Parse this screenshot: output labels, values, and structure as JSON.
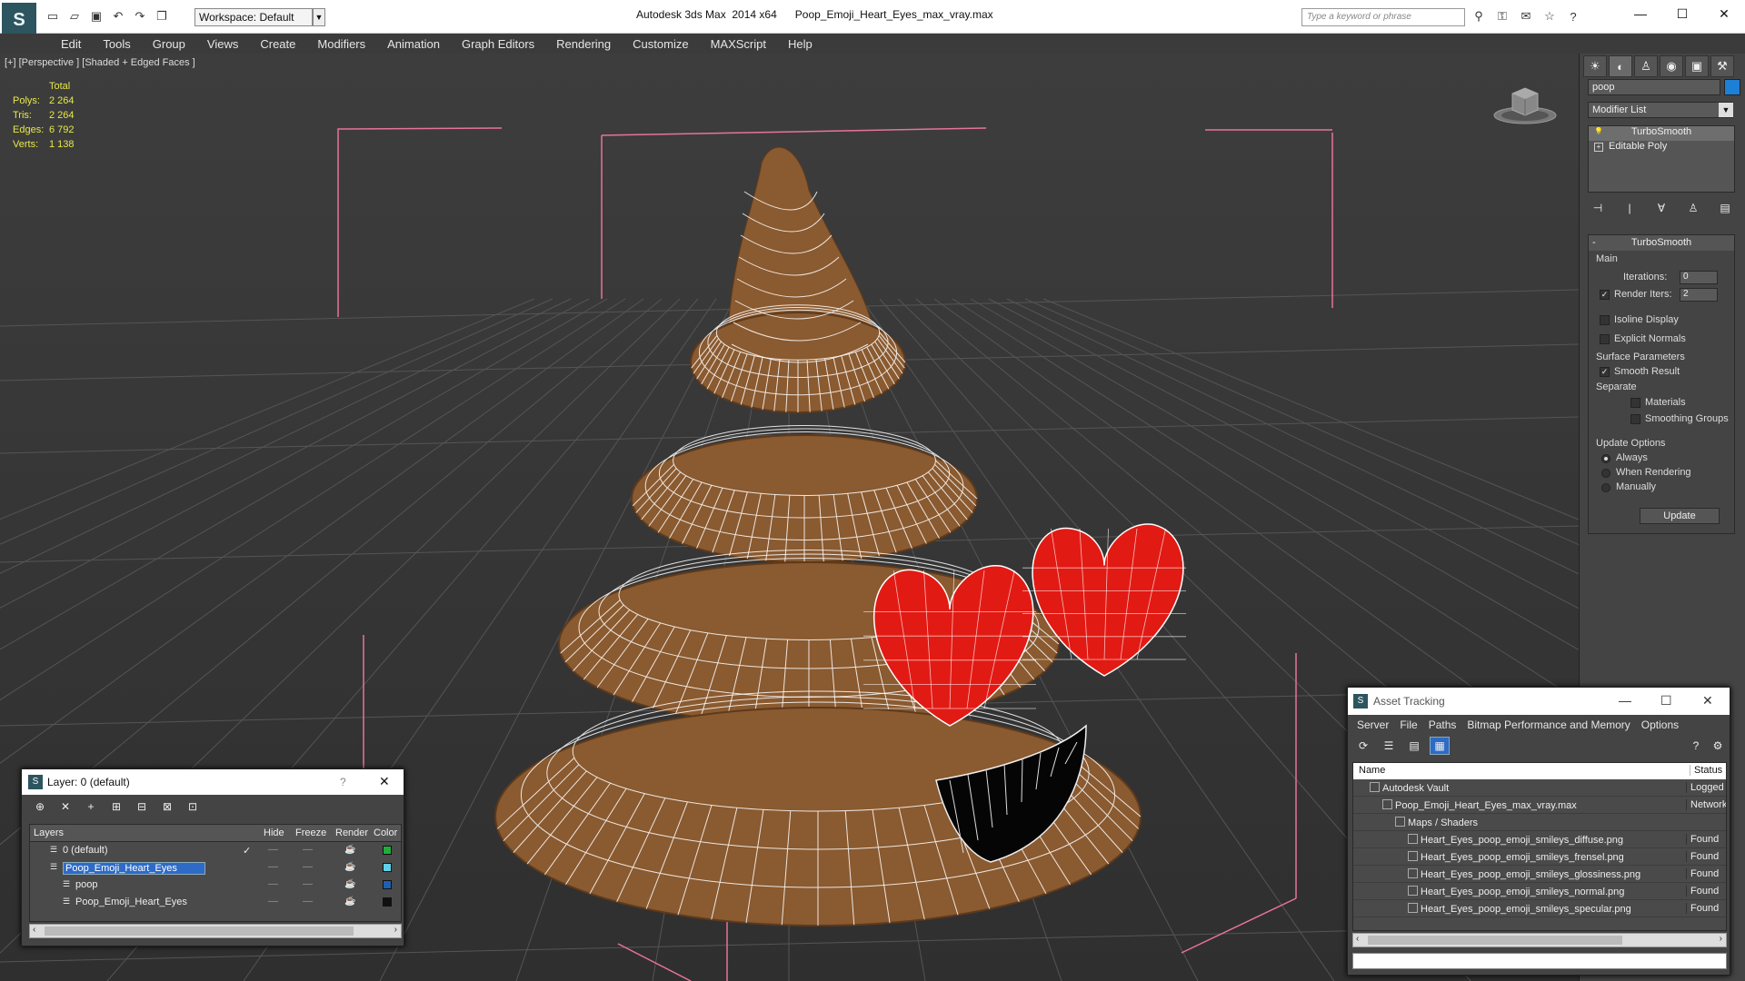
{
  "app": {
    "logo_glyph": "S",
    "title": "Autodesk 3ds Max  2014 x64      Poop_Emoji_Heart_Eyes_max_vray.max",
    "workspace": "Workspace: Default",
    "search_placeholder": "Type a keyword or phrase"
  },
  "quick_access": [
    {
      "name": "new-file-icon",
      "glyph": "▭"
    },
    {
      "name": "open-file-icon",
      "glyph": "▱"
    },
    {
      "name": "save-icon",
      "glyph": "▣"
    },
    {
      "name": "undo-icon",
      "glyph": "↶"
    },
    {
      "name": "redo-icon",
      "glyph": "↷"
    },
    {
      "name": "project-folder-icon",
      "glyph": "❐"
    }
  ],
  "menu": [
    "Edit",
    "Tools",
    "Group",
    "Views",
    "Create",
    "Modifiers",
    "Animation",
    "Graph Editors",
    "Rendering",
    "Customize",
    "MAXScript",
    "Help"
  ],
  "viewport": {
    "label": "[+] [Perspective ] [Shaded + Edged Faces ]",
    "stats_header": "Total",
    "stats": [
      {
        "label": "Polys:",
        "value": "2 264"
      },
      {
        "label": "Tris:",
        "value": "2 264"
      },
      {
        "label": "Edges:",
        "value": "6 792"
      },
      {
        "label": "Verts:",
        "value": "1 138"
      }
    ],
    "colors": {
      "poop": "#8a5a30",
      "poop_dark": "#5e3a1c",
      "heart": "#e21a14",
      "wire": "#ffffff",
      "bbox": "#e8739a",
      "grid": "#555555"
    }
  },
  "command_panel": {
    "tabs": [
      "☀",
      "◐",
      "♙",
      "◉",
      "▣",
      "⚒"
    ],
    "object_name": "poop",
    "object_color": "#1e7fd6",
    "modifier_list": "Modifier List",
    "stack": [
      "TurboSmooth",
      "Editable Poly"
    ],
    "stack_tools": [
      "⊣",
      "|",
      "∀",
      "♙",
      "▤"
    ],
    "turbosmooth": {
      "header": "TurboSmooth",
      "main": "Main",
      "iterations_label": "Iterations:",
      "iterations": "0",
      "render_iters_label": "Render Iters:",
      "render_iters": "2",
      "isoline": "Isoline Display",
      "explicit_normals": "Explicit Normals",
      "surface_params": "Surface Parameters",
      "smooth_result": "Smooth Result",
      "separate": "Separate",
      "materials": "Materials",
      "smoothing_groups": "Smoothing Groups",
      "update_options": "Update Options",
      "always": "Always",
      "when_rendering": "When Rendering",
      "manually": "Manually",
      "update": "Update"
    }
  },
  "layer_dialog": {
    "title": "Layer: 0 (default)",
    "help": "?",
    "close": "✕",
    "tools": [
      "⊕",
      "✕",
      "+",
      "⊞",
      "⊟",
      "⊠",
      "⊡"
    ],
    "columns": [
      "Layers",
      "Hide",
      "Freeze",
      "Render",
      "Color"
    ],
    "rows": [
      {
        "name": "0 (default)",
        "check": "✓",
        "color": "#1fae3a",
        "indent": 0
      },
      {
        "name": "Poop_Emoji_Heart_Eyes",
        "check": "",
        "color": "#5fd0e8",
        "indent": 0,
        "selected": true
      },
      {
        "name": "poop",
        "check": "",
        "color": "#1e5fb0",
        "indent": 1
      },
      {
        "name": "Poop_Emoji_Heart_Eyes",
        "check": "",
        "color": "#111111",
        "indent": 1
      }
    ]
  },
  "asset_tracking": {
    "title": "Asset Tracking",
    "menu": [
      "Server",
      "File",
      "Paths",
      "Bitmap Performance and Memory",
      "Options"
    ],
    "columns": [
      "Name",
      "Status"
    ],
    "rows": [
      {
        "name": "Autodesk Vault",
        "status": "Logged O",
        "indent": 1
      },
      {
        "name": "Poop_Emoji_Heart_Eyes_max_vray.max",
        "status": "Network I",
        "indent": 2
      },
      {
        "name": "Maps / Shaders",
        "status": "",
        "indent": 3
      },
      {
        "name": "Heart_Eyes_poop_emoji_smileys_diffuse.png",
        "status": "Found",
        "indent": 4
      },
      {
        "name": "Heart_Eyes_poop_emoji_smileys_frensel.png",
        "status": "Found",
        "indent": 4
      },
      {
        "name": "Heart_Eyes_poop_emoji_smileys_glossiness.png",
        "status": "Found",
        "indent": 4
      },
      {
        "name": "Heart_Eyes_poop_emoji_smileys_normal.png",
        "status": "Found",
        "indent": 4
      },
      {
        "name": "Heart_Eyes_poop_emoji_smileys_specular.png",
        "status": "Found",
        "indent": 4
      }
    ]
  }
}
